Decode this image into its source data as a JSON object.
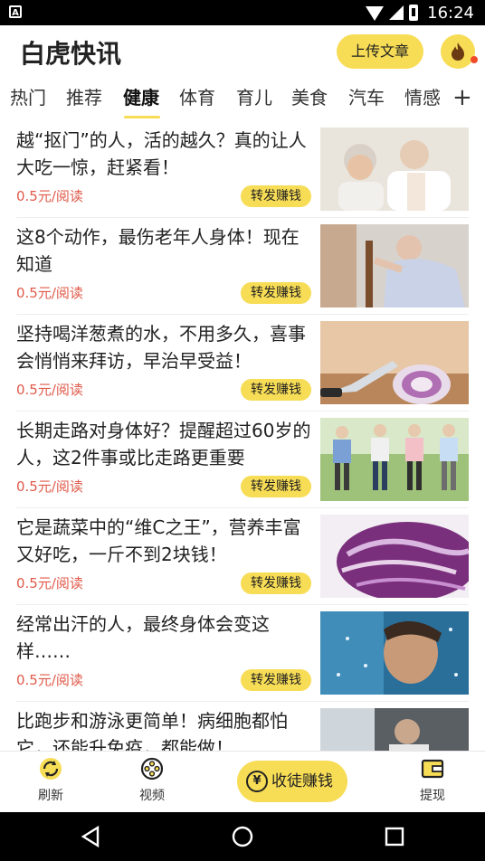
{
  "status_bar": {
    "time": "16:24",
    "left_icon_letter": "A"
  },
  "header": {
    "app_title": "白虎快讯",
    "upload_button": "上传文章",
    "fire_icon": "fire-icon"
  },
  "tabs": {
    "items": [
      "热门",
      "推荐",
      "健康",
      "体育",
      "育儿",
      "美食",
      "汽车",
      "情感"
    ],
    "active": "健康",
    "more": "+"
  },
  "articles": [
    {
      "title": "越“抠门”的人，活的越久？真的让人大吃一惊，赶紧看！",
      "price": "0.5元/阅读",
      "share": "转发赚钱"
    },
    {
      "title": "这8个动作，最伤老年人身体！现在知道",
      "price": "0.5元/阅读",
      "share": "转发赚钱"
    },
    {
      "title": "坚持喝洋葱煮的水，不用多久，喜事会悄悄来拜访，早治早受益！",
      "price": "0.5元/阅读",
      "share": "转发赚钱"
    },
    {
      "title": "长期走路对身体好？提醒超过60岁的人，这2件事或比走路更重要",
      "price": "0.5元/阅读",
      "share": "转发赚钱"
    },
    {
      "title": "它是蔬菜中的“维C之王”，营养丰富又好吃，一斤不到2块钱！",
      "price": "0.5元/阅读",
      "share": "转发赚钱"
    },
    {
      "title": "经常出汗的人，最终身体会变这样……",
      "price": "0.5元/阅读",
      "share": "转发赚钱"
    },
    {
      "title": "比跑步和游泳更简单！病细胞都怕它，还能升免疫，都能做！",
      "price": "",
      "share": ""
    }
  ],
  "bottom_nav": {
    "refresh": "刷新",
    "video": "视频",
    "recruit": "收徒赚钱",
    "withdraw": "提现"
  },
  "colors": {
    "accent": "#f7dc55",
    "price": "#e05a4a",
    "badge_dot": "#f04a2a"
  }
}
